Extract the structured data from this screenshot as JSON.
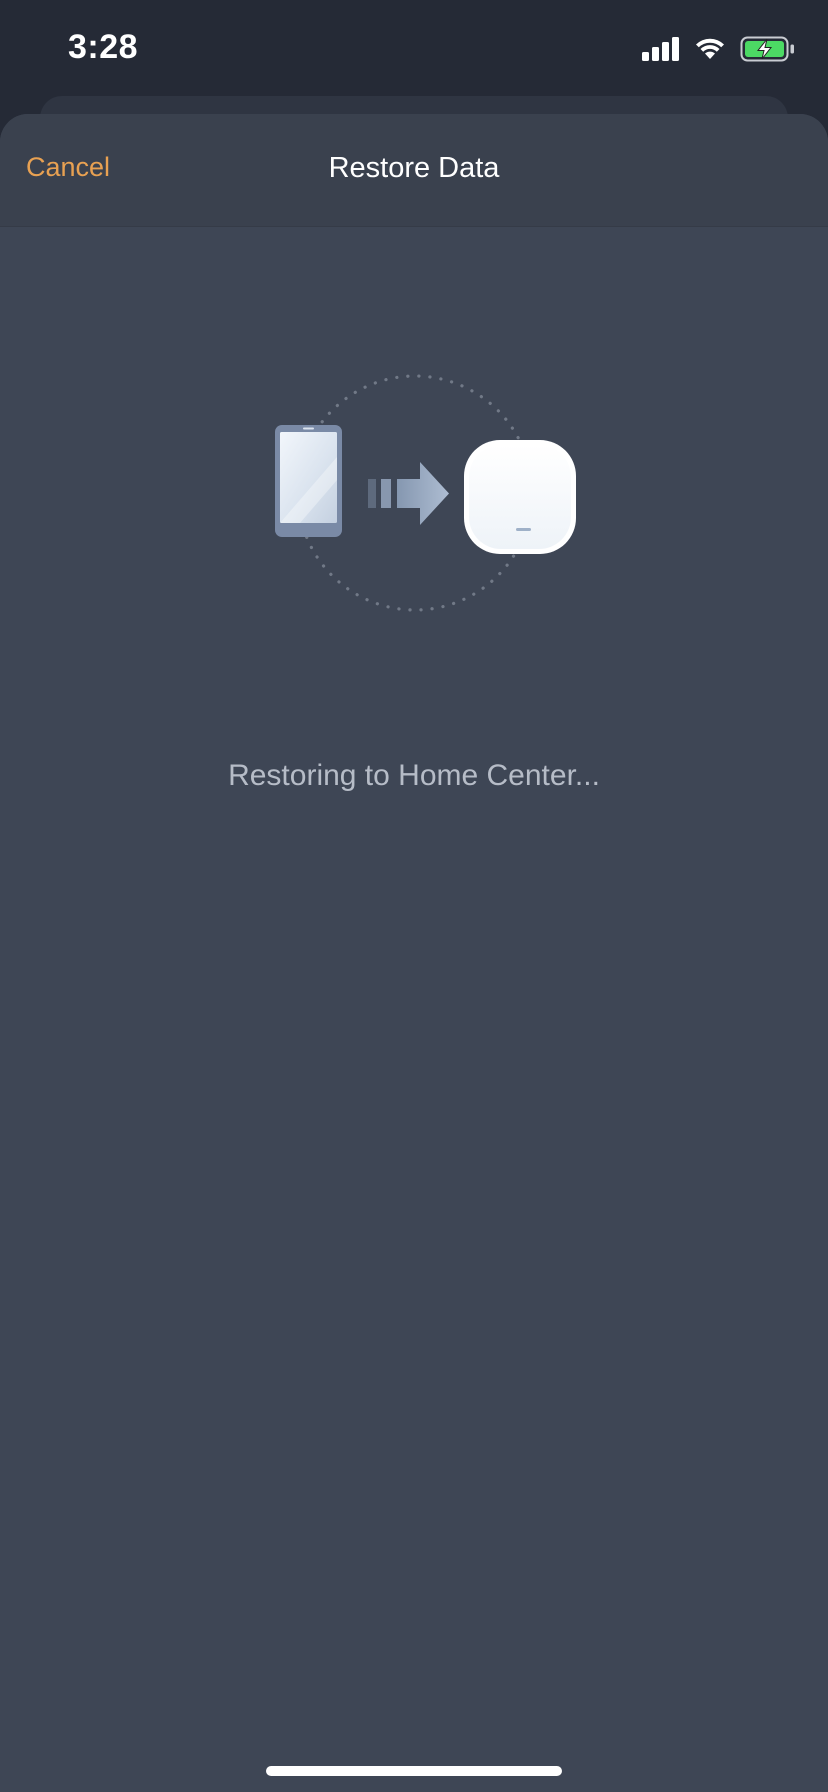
{
  "status_bar": {
    "time": "3:28",
    "icons": [
      "cellular-signal-icon",
      "wifi-icon",
      "battery-charging-icon"
    ],
    "battery_color": "#4cd964"
  },
  "nav": {
    "cancel_label": "Cancel",
    "title": "Restore Data"
  },
  "illustration": {
    "icons": [
      "phone-icon",
      "transfer-arrow-icon",
      "home-center-hub-icon"
    ]
  },
  "status_message": "Restoring to Home Center...",
  "colors": {
    "accent": "#e8a152",
    "background": "#3e4655",
    "nav_background": "#3a414e",
    "status_bar_background": "#252a36"
  }
}
